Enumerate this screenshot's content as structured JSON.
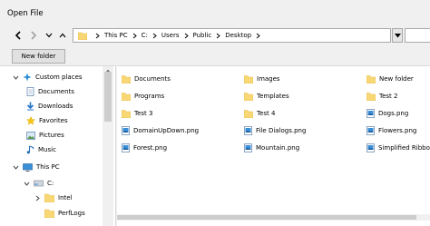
{
  "window": {
    "title": "Open File"
  },
  "address_bar": {
    "segments": [
      "This PC",
      "C:",
      "Users",
      "Public",
      "Desktop"
    ]
  },
  "toolbar": {
    "new_folder_label": "New folder"
  },
  "navigation": {
    "items": [
      {
        "label": "Custom places",
        "icon": "star-sparkle-icon",
        "expanded": true
      },
      {
        "label": "Documents",
        "icon": "documents-icon"
      },
      {
        "label": "Downloads",
        "icon": "download-arrow-icon"
      },
      {
        "label": "Favorites",
        "icon": "star-icon"
      },
      {
        "label": "Pictures",
        "icon": "pictures-icon"
      },
      {
        "label": "Music",
        "icon": "music-note-icon"
      },
      {
        "label": "This PC",
        "icon": "computer-icon",
        "expanded": true
      },
      {
        "label": "C:",
        "icon": "drive-icon",
        "expanded": true
      },
      {
        "label": "Intel",
        "icon": "folder-icon"
      },
      {
        "label": "PerfLogs",
        "icon": "folder-icon"
      }
    ]
  },
  "files": [
    {
      "name": "Documents",
      "type": "folder"
    },
    {
      "name": "Images",
      "type": "folder"
    },
    {
      "name": "New folder",
      "type": "folder"
    },
    {
      "name": "Programs",
      "type": "folder"
    },
    {
      "name": "Templates",
      "type": "folder"
    },
    {
      "name": "Test 2",
      "type": "folder"
    },
    {
      "name": "Test 3",
      "type": "folder"
    },
    {
      "name": "Test 4",
      "type": "folder"
    },
    {
      "name": "Dogs.png",
      "type": "image"
    },
    {
      "name": "DomainUpDown.png",
      "type": "image"
    },
    {
      "name": "File Dialogs.png",
      "type": "image"
    },
    {
      "name": "Flowers.png",
      "type": "image"
    },
    {
      "name": "Forest.png",
      "type": "image"
    },
    {
      "name": "Mountain.png",
      "type": "image"
    },
    {
      "name": "Simplified Ribbo",
      "type": "image"
    }
  ],
  "colors": {
    "folder": "#f8d775",
    "folder_dark": "#e8b94a",
    "accent": "#1e73c8"
  }
}
